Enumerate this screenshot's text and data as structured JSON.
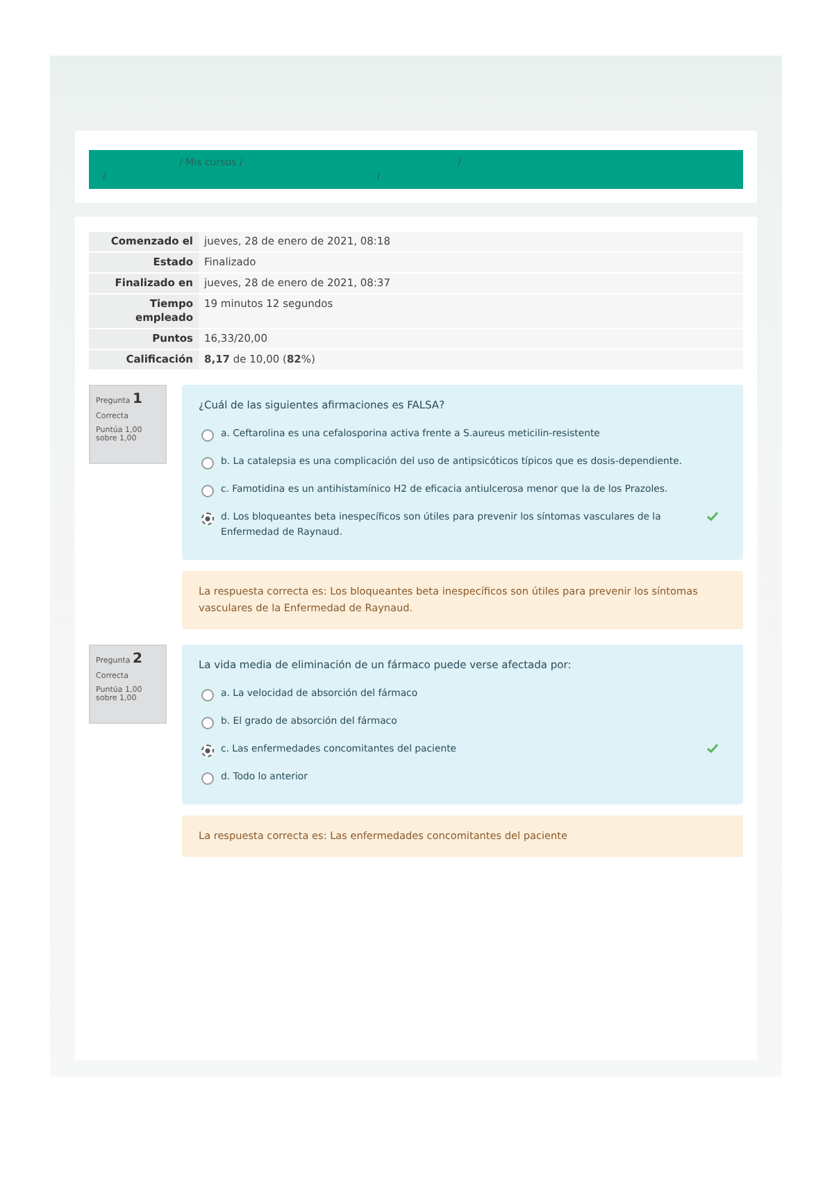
{
  "breadcrumb": {
    "line_1": [
      "/ Mis cursos /",
      "/"
    ],
    "line_2": [
      "/",
      "/"
    ]
  },
  "summary": [
    {
      "label": "Comenzado el",
      "value": "jueves, 28 de enero de 2021, 08:18"
    },
    {
      "label": "Estado",
      "value": "Finalizado"
    },
    {
      "label": "Finalizado en",
      "value": "jueves, 28 de enero de 2021, 08:37"
    },
    {
      "label": "Tiempo empleado",
      "value": "19 minutos 12 segundos"
    },
    {
      "label": "Puntos",
      "value": "16,33/20,00"
    },
    {
      "label": "Calificación",
      "value": "**8,17** de 10,00 (**82**%)"
    }
  ],
  "questions": [
    {
      "label": "Pregunta",
      "number": "1",
      "status": "Correcta",
      "score": "Puntúa 1,00 sobre 1,00",
      "text": "¿Cuál de las siguientes afirmaciones es FALSA?",
      "options": [
        {
          "text": "a. Ceftarolina es una cefalosporina activa frente a S.aureus meticilin-resistente",
          "selected": false,
          "correct": false
        },
        {
          "text": "b. La catalepsia es una complicación del uso de antipsicóticos típicos que es dosis-dependiente.",
          "selected": false,
          "correct": false
        },
        {
          "text": "c. Famotidina es un antihistamínico H2 de eficacia antiulcerosa menor que la de los Prazoles.",
          "selected": false,
          "correct": false
        },
        {
          "text": "d. Los bloqueantes beta inespecíficos son útiles para prevenir los síntomas vasculares de la Enfermedad de Raynaud.",
          "selected": true,
          "correct": true
        }
      ],
      "feedback": "La respuesta correcta es: Los bloqueantes beta inespecíficos son útiles para prevenir los síntomas vasculares de la Enfermedad de Raynaud."
    },
    {
      "label": "Pregunta",
      "number": "2",
      "status": "Correcta",
      "score": "Puntúa 1,00 sobre 1,00",
      "text": "La vida media de eliminación de un fármaco puede verse afectada por:",
      "options": [
        {
          "text": "a. La velocidad de absorción del fármaco",
          "selected": false,
          "correct": false
        },
        {
          "text": "b. El grado de absorción del fármaco",
          "selected": false,
          "correct": false
        },
        {
          "text": "c. Las enfermedades concomitantes del paciente",
          "selected": true,
          "correct": true
        },
        {
          "text": "d. Todo lo anterior",
          "selected": false,
          "correct": false
        }
      ],
      "feedback": "La respuesta correcta es: Las enfermedades concomitantes del paciente"
    }
  ]
}
